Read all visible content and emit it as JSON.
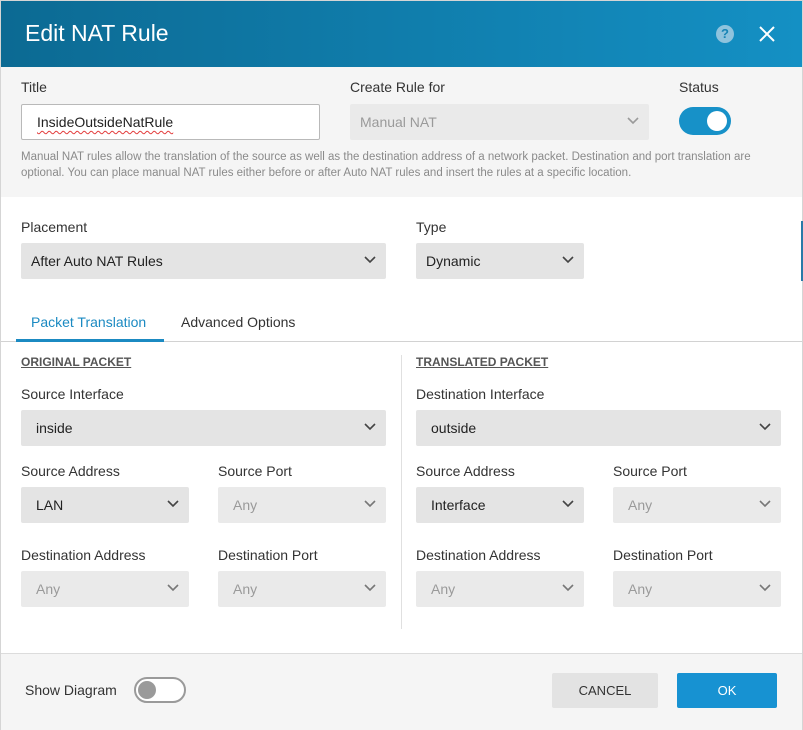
{
  "dialog": {
    "title": "Edit NAT Rule",
    "help_icon": "?",
    "colors": {
      "header_start": "#0c6a93",
      "header_end": "#1490c4",
      "accent": "#1791c8",
      "ok": "#1792d2"
    }
  },
  "rule": {
    "title_label": "Title",
    "title_value": "InsideOutsideNatRule",
    "create_for_label": "Create Rule for",
    "create_for_value": "Manual NAT",
    "status_label": "Status",
    "status_enabled": true,
    "description": "Manual NAT rules allow the translation of the source as well as the destination address of a network packet. Destination and port translation are optional. You can place manual NAT rules either before or after Auto NAT rules and insert the rules at a specific location."
  },
  "placement": {
    "label": "Placement",
    "value": "After Auto NAT Rules"
  },
  "type": {
    "label": "Type",
    "value": "Dynamic"
  },
  "tabs": [
    {
      "label": "Packet Translation",
      "active": true
    },
    {
      "label": "Advanced Options",
      "active": false
    }
  ],
  "original": {
    "heading": "ORIGINAL PACKET",
    "src_if_label": "Source Interface",
    "src_if_value": "inside",
    "src_addr_label": "Source Address",
    "src_addr_value": "LAN",
    "src_port_label": "Source Port",
    "src_port_value": "Any",
    "dst_addr_label": "Destination Address",
    "dst_addr_value": "Any",
    "dst_port_label": "Destination Port",
    "dst_port_value": "Any"
  },
  "translated": {
    "heading": "TRANSLATED PACKET",
    "dst_if_label": "Destination Interface",
    "dst_if_value": "outside",
    "src_addr_label": "Source Address",
    "src_addr_value": "Interface",
    "src_port_label": "Source Port",
    "src_port_value": "Any",
    "dst_addr_label": "Destination Address",
    "dst_addr_value": "Any",
    "dst_port_label": "Destination Port",
    "dst_port_value": "Any"
  },
  "footer": {
    "show_diagram_label": "Show Diagram",
    "show_diagram_enabled": false,
    "cancel_label": "CANCEL",
    "ok_label": "OK"
  }
}
